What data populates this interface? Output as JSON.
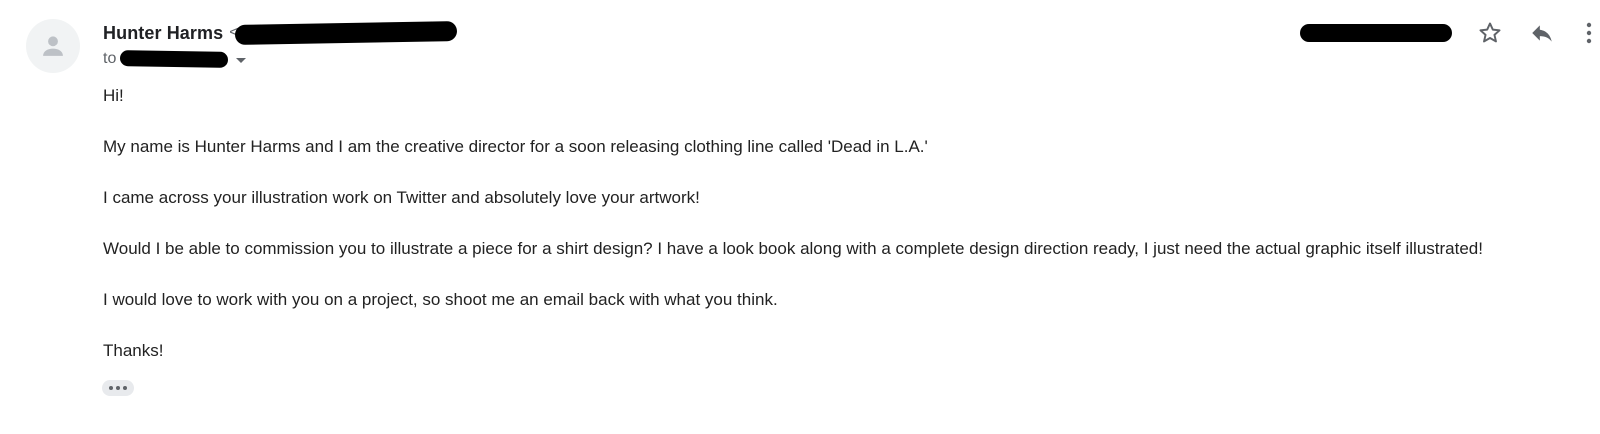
{
  "sender": {
    "name": "Hunter Harms",
    "email_open": "<"
  },
  "recipient": {
    "prefix": "to"
  },
  "actions": {
    "star_icon": "star-outline-icon",
    "reply_icon": "reply-arrow-icon",
    "more_icon": "vertical-dots-icon"
  },
  "message": {
    "paragraphs": [
      "Hi!",
      "My name is Hunter Harms and I am the creative director for a soon releasing clothing line called 'Dead in L.A.'",
      "I came across your illustration work on Twitter and absolutely love your artwork!",
      "Would I be able to commission you to illustrate a piece for a shirt design? I have a look book along with a complete design direction ready, I just need the actual graphic itself illustrated!",
      "I would love to work with you on a project, so shoot me an email back with what you think.",
      "Thanks!"
    ]
  },
  "colors": {
    "icon": "#5f6368",
    "text": "#222222",
    "avatar_bg": "#f1f3f4",
    "avatar_fg": "#9aa0a6"
  }
}
